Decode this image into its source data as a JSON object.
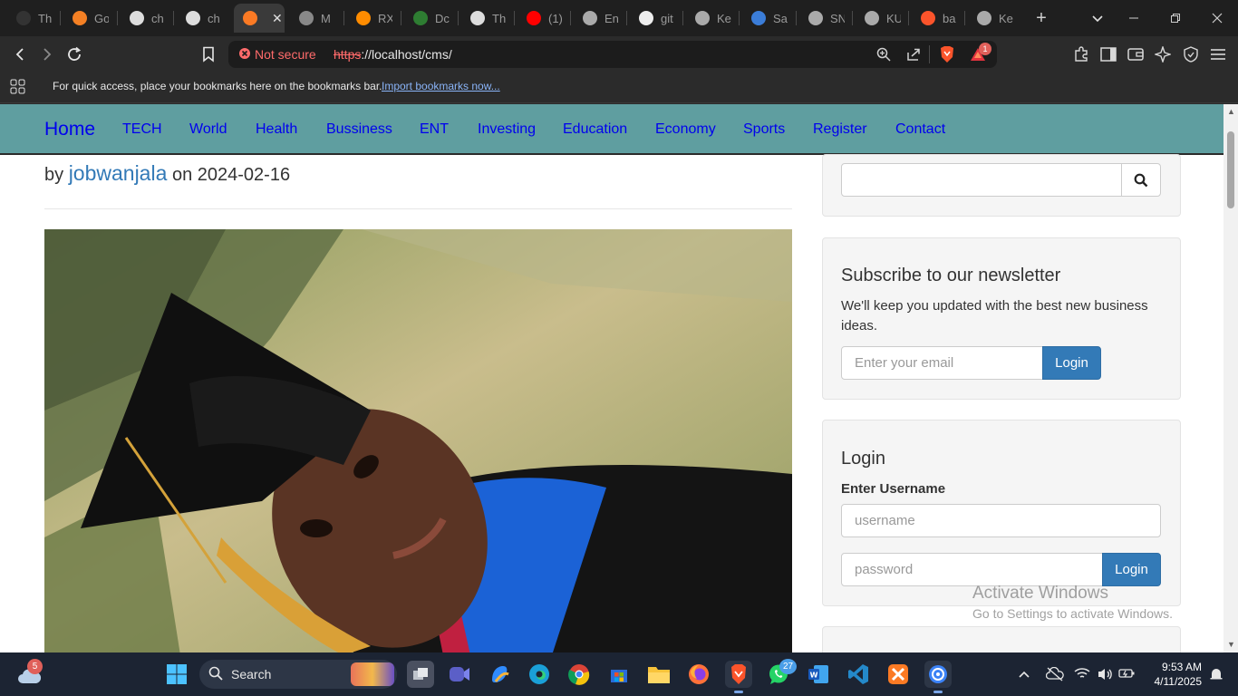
{
  "browser": {
    "tabs": [
      {
        "title": "Th",
        "icon": "github-icon",
        "color": "#333333"
      },
      {
        "title": "Go",
        "icon": "stack-icon",
        "color": "#f48024"
      },
      {
        "title": "ch",
        "icon": "openai-icon",
        "color": "#dddddd"
      },
      {
        "title": "ch",
        "icon": "openai-icon",
        "color": "#dddddd"
      },
      {
        "title": "",
        "icon": "xampp-icon",
        "color": "#fb7a24",
        "active": true
      },
      {
        "title": "M",
        "icon": "site-icon",
        "color": "#888888"
      },
      {
        "title": "RX",
        "icon": "orange-icon",
        "color": "#ff8c00"
      },
      {
        "title": "Dc",
        "icon": "cw-icon",
        "color": "#2e7d32"
      },
      {
        "title": "Th",
        "icon": "bank-icon",
        "color": "#dddddd"
      },
      {
        "title": "(1)",
        "icon": "youtube-icon",
        "color": "#ff0000"
      },
      {
        "title": "En",
        "icon": "globe-icon",
        "color": "#aaaaaa"
      },
      {
        "title": "git",
        "icon": "github-icon",
        "color": "#eeeeee"
      },
      {
        "title": "Ke",
        "icon": "globe-icon",
        "color": "#aaaaaa"
      },
      {
        "title": "Sa",
        "icon": "site-icon",
        "color": "#3b7dd8"
      },
      {
        "title": "SN",
        "icon": "globe-icon",
        "color": "#aaaaaa"
      },
      {
        "title": "KU",
        "icon": "globe-icon",
        "color": "#aaaaaa"
      },
      {
        "title": "ba",
        "icon": "brave-icon",
        "color": "#fb542b"
      },
      {
        "title": "Ke",
        "icon": "globe-icon",
        "color": "#aaaaaa"
      }
    ],
    "security_status": "Not secure",
    "url_scheme": "https",
    "url_rest": "://localhost/cms/",
    "rewards_badge": "1",
    "bookmarks_hint": "For quick access, place your bookmarks here on the bookmarks bar.",
    "import_link": "Import bookmarks now..."
  },
  "site": {
    "nav": {
      "home": "Home",
      "items": [
        "TECH",
        "World",
        "Health",
        "Bussiness",
        "ENT",
        "Investing",
        "Education",
        "Economy",
        "Sports",
        "Register",
        "Contact"
      ]
    },
    "post": {
      "by": "by",
      "author": "jobwanjala",
      "on": "on",
      "date": "2024-02-16",
      "image_alt": "graduate selfie"
    },
    "sidebar": {
      "search_placeholder": "",
      "newsletter": {
        "title": "Subscribe to our newsletter",
        "text": "We'll keep you updated with the best new business ideas.",
        "email_placeholder": "Enter your email",
        "button": "Login"
      },
      "login": {
        "title": "Login",
        "username_label": "Enter Username",
        "username_placeholder": "username",
        "password_placeholder": "password",
        "button": "Login"
      }
    }
  },
  "watermark": {
    "line1": "Activate Windows",
    "line2": "Go to Settings to activate Windows."
  },
  "taskbar": {
    "search_label": "Search",
    "weather_badge": "5",
    "whatsapp_badge": "27",
    "time": "9:53 AM",
    "date": "4/11/2025"
  }
}
